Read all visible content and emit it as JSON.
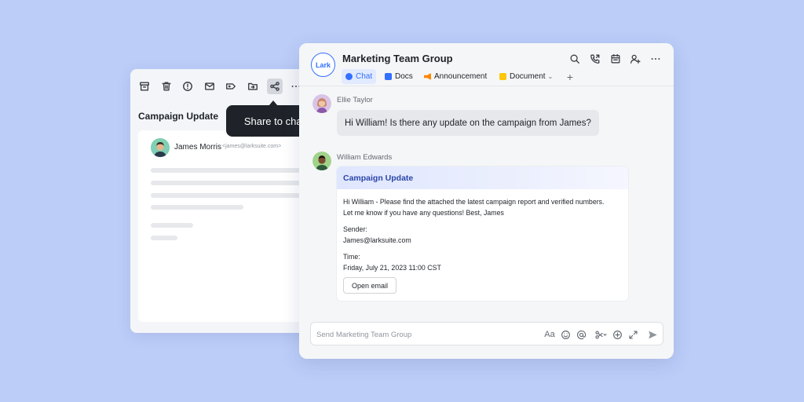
{
  "email": {
    "toolbar_icons": [
      "archive-icon",
      "trash-icon",
      "alert-icon",
      "mail-icon",
      "tag-icon",
      "move-folder-icon",
      "share-icon",
      "more-icon"
    ],
    "subject": "Campaign Update",
    "sender_name": "James Morris",
    "sender_email": "<james@larksuite.com>"
  },
  "tooltip": {
    "text": "Share to chat"
  },
  "chat": {
    "logo_text": "Lark",
    "group_title": "Marketing Team Group",
    "header_icons": [
      "search-icon",
      "call-icon",
      "calendar-icon",
      "add-member-icon",
      "more-icon"
    ],
    "tabs": [
      {
        "label": "Chat",
        "icon": "chat-icon",
        "color": "#3370ff"
      },
      {
        "label": "Docs",
        "icon": "docs-icon",
        "color": "#3370ff"
      },
      {
        "label": "Announcement",
        "icon": "announcement-icon",
        "color": "#ff8800"
      },
      {
        "label": "Document",
        "icon": "folder-icon",
        "color": "#ffc60a"
      }
    ],
    "add_tab": "+",
    "messages": [
      {
        "name": "Ellie Taylor",
        "text": "Hi William! Is there any update on the campaign from James?"
      },
      {
        "name": "William Edwards"
      }
    ],
    "card": {
      "title": "Campaign Update",
      "body_line1": "Hi William - Please find the attached the latest campaign report and verified numbers.",
      "body_line2": "Let me know if you have any questions! Best, James",
      "sender_label": "Sender:",
      "sender_value": "James@larksuite.com",
      "time_label": "Time:",
      "time_value": "Friday, July 21, 2023 11:00 CST",
      "button": "Open email"
    },
    "composer": {
      "placeholder": "Send Marketing Team Group",
      "font_glyph": "Aa"
    }
  },
  "colors": {
    "background": "#bccdf8",
    "accent": "#3370ff",
    "tooltip": "#1f2329"
  }
}
